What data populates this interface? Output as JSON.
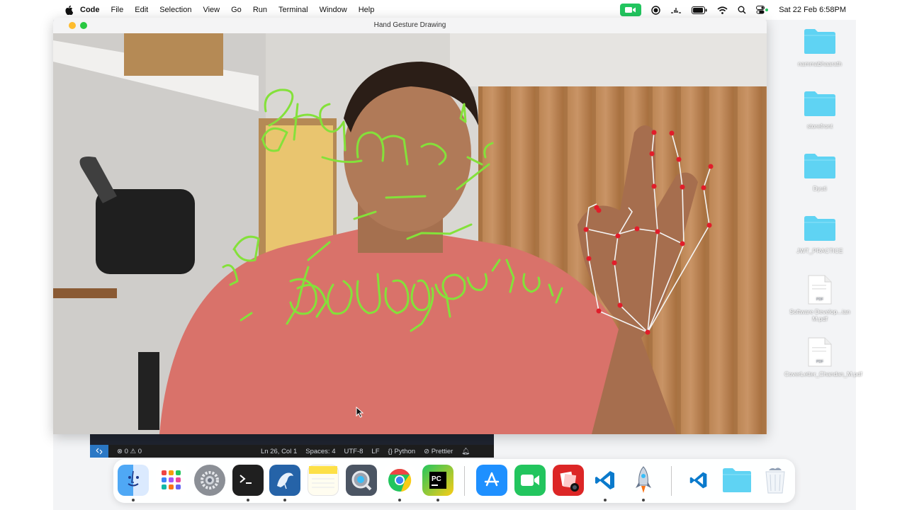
{
  "menubar": {
    "items": [
      "Code",
      "File",
      "Edit",
      "Selection",
      "View",
      "Go",
      "Run",
      "Terminal",
      "Window",
      "Help"
    ],
    "datetime": "Sat 22 Feb  6:58PM"
  },
  "window": {
    "title": "Hand Gesture Drawing",
    "camera_overlay": {
      "stroke_color": "#84e13a",
      "landmark_color": "#e11d2a",
      "connector_color": "#f5f5f5"
    }
  },
  "vscode": {
    "errors": "0",
    "warnings": "0",
    "cursor": "Ln 26, Col 1",
    "spaces": "Spaces: 4",
    "encoding": "UTF-8",
    "eol": "LF",
    "language": "Python",
    "formatter": "Prettier"
  },
  "desktop": [
    {
      "label": "nammabhaarath",
      "icon": "folder-icon"
    },
    {
      "label": "storefront",
      "icon": "folder-icon"
    },
    {
      "label": "Dyuti",
      "icon": "folder-icon"
    },
    {
      "label": "JWT_PRACTICE",
      "icon": "folder-icon"
    },
    {
      "label": "Software Develop...ian M.pdf",
      "icon": "pdf-icon"
    },
    {
      "label": "CoverLetter_Chandan_M.pdf",
      "icon": "pdf-icon"
    }
  ],
  "dock": [
    "finder-icon",
    "launchpad-icon",
    "system-settings-icon",
    "terminal-icon",
    "mysql-workbench-icon",
    "notes-icon",
    "quicktime-icon",
    "chrome-icon",
    "pycharm-icon",
    "app-store-icon",
    "facetime-icon",
    "photo-booth-icon",
    "vscode-icon",
    "rocket-icon",
    "vscode-insiders-icon",
    "downloads-folder-icon",
    "trash-icon"
  ],
  "colors": {
    "folder": "#5fd3f3",
    "facetime_pill": "#22c55e",
    "vscode_remote": "#2b78c5"
  }
}
